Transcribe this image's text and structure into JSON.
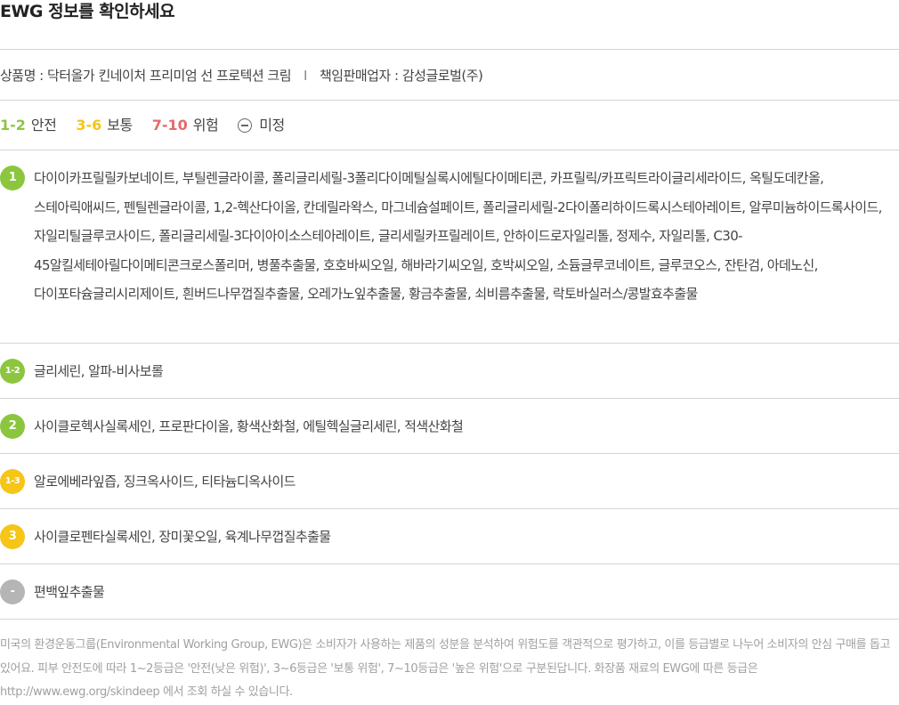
{
  "header": {
    "title": "EWG 정보를 확인하세요"
  },
  "product": {
    "name_label": "상품명 : 닥터올가 킨네이처 프리미엄 선 프로텍션 크림",
    "separator": "I",
    "seller_label": "책임판매업자 : 감성글로벌(주)"
  },
  "legend": {
    "safe_range": "1-2",
    "safe_label": "안전",
    "moderate_range": "3-6",
    "moderate_label": "보통",
    "danger_range": "7-10",
    "danger_label": "위험",
    "undetermined_label": "미정"
  },
  "colors": {
    "safe": "#8cc63f",
    "moderate": "#f5c518",
    "danger": "#e86a6a",
    "undetermined": "#b5b5b5"
  },
  "ingredient_groups": [
    {
      "grade": "1",
      "color": "green",
      "ingredients": "다이이카프릴릴카보네이트, 부틸렌글라이콜, 폴리글리세릴-3폴리다이메틸실록시에틸다이메티콘, 카프릴릭/카프릭트라이글리세라이드, 옥틸도데칸올, 스테아릭애씨드, 펜틸렌글라이콜, 1,2-헥산다이올, 칸데릴라왁스, 마그네슘설페이트, 폴리글리세릴-2다이폴리하이드록시스테아레이트, 알루미늄하이드록사이드, 자일리틸글루코사이드, 폴리글리세릴-3다이아이소스테아레이트, 글리세릴카프릴레이트, 안하이드로자일리톨, 정제수, 자일리톨, C30-45알킬세테아릴다이메티콘크로스폴리머, 병풀추출물, 호호바씨오일, 해바라기씨오일, 호박씨오일, 소듐글루코네이트, 글루코오스, 잔탄검, 아데노신, 다이포타슘글리시리제이트, 흰버드나무껍질추출물, 오레가노잎추출물, 황금추출물, 쇠비름추출물, 락토바실러스/콩발효추출물"
    },
    {
      "grade": "1-2",
      "color": "green",
      "ingredients": "글리세린, 알파-비사보롤"
    },
    {
      "grade": "2",
      "color": "green",
      "ingredients": "사이클로헥사실록세인, 프로판다이올, 황색산화철, 에틸헥실글리세린, 적색산화철"
    },
    {
      "grade": "1-3",
      "color": "yellow",
      "ingredients": "알로에베라잎즙, 징크옥사이드, 티타늄디옥사이드"
    },
    {
      "grade": "3",
      "color": "yellow",
      "ingredients": "사이클로펜타실록세인, 장미꽃오일, 육계나무껍질추출물"
    },
    {
      "grade": "-",
      "color": "gray",
      "ingredients": "편백잎추출물"
    }
  ],
  "footer_note": "미국의 환경운동그룹(Environmental Working Group, EWG)은 소비자가 사용하는 제품의 성분을 분석하여 위험도를 객관적으로 평가하고, 이를 등급별로 나누어 소비자의 안심 구매를 돕고 있어요. 피부 안전도에 따라 1~2등급은 '안전(낮은 위험)', 3~6등급은 '보통 위험', 7~10등급은 '높은 위험'으로 구분된답니다. 화장품 재료의 EWG에 따른 등급은 http://www.ewg.org/skindeep 에서 조회 하실 수 있습니다."
}
